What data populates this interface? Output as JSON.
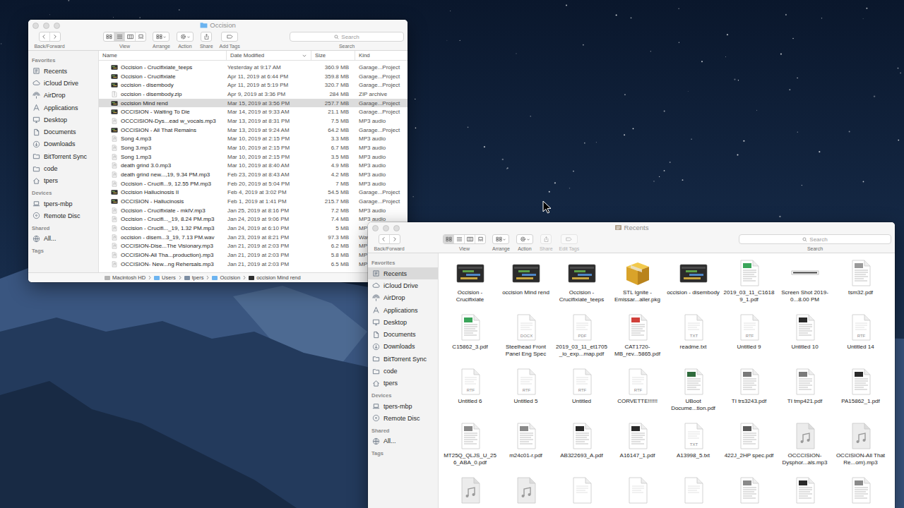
{
  "windows": [
    {
      "kind": "list",
      "title": "Occision",
      "active": false,
      "toolbar": [
        {
          "label": "Back/Forward",
          "kind": "nav",
          "disabled": false
        },
        {
          "label": "View",
          "kind": "view",
          "disabled": false
        },
        {
          "label": "Arrange",
          "kind": "arrange",
          "disabled": false
        },
        {
          "label": "Action",
          "kind": "action",
          "disabled": false
        },
        {
          "label": "Share",
          "kind": "share",
          "disabled": false
        },
        {
          "label": "Add Tags",
          "kind": "tags",
          "disabled": false
        }
      ],
      "view_modes": [
        {
          "kind": "icon",
          "selected": false
        },
        {
          "kind": "list",
          "selected": true
        },
        {
          "kind": "column",
          "selected": false
        },
        {
          "kind": "gallery",
          "selected": false
        }
      ],
      "search": {
        "placeholder": "Search",
        "label": "Search"
      },
      "sidebar": [
        {
          "heading": "Favorites",
          "items": [
            {
              "label": "Recents",
              "kind": "recents",
              "selected": false
            },
            {
              "label": "iCloud Drive",
              "kind": "cloud",
              "selected": false
            },
            {
              "label": "AirDrop",
              "kind": "airdrop",
              "selected": false
            },
            {
              "label": "Applications",
              "kind": "apps",
              "selected": false
            },
            {
              "label": "Desktop",
              "kind": "desktop",
              "selected": false
            },
            {
              "label": "Documents",
              "kind": "documents",
              "selected": false
            },
            {
              "label": "Downloads",
              "kind": "downloads",
              "selected": false
            },
            {
              "label": "BitTorrent Sync",
              "kind": "folder",
              "selected": false
            },
            {
              "label": "code",
              "kind": "folder",
              "selected": false
            },
            {
              "label": "tpers",
              "kind": "home",
              "selected": false
            }
          ]
        },
        {
          "heading": "Devices",
          "items": [
            {
              "label": "tpers-mbp",
              "kind": "laptop",
              "selected": false
            },
            {
              "label": "Remote Disc",
              "kind": "disc",
              "selected": false
            }
          ]
        },
        {
          "heading": "Shared",
          "items": [
            {
              "label": "All...",
              "kind": "network",
              "selected": false
            }
          ]
        },
        {
          "heading": "Tags",
          "items": []
        }
      ],
      "columns": [
        {
          "label": "Name",
          "sorted": false
        },
        {
          "label": "Date Modified",
          "sorted": true
        },
        {
          "label": "Size",
          "sorted": false
        },
        {
          "label": "Kind",
          "sorted": false
        }
      ],
      "rows": [
        {
          "name": "Occision - Crucifixiate_teeps",
          "date": "Yesterday at 9:17 AM",
          "size": "360.9 MB",
          "kind_label": "Garage...Project",
          "kind": "project",
          "selected": false
        },
        {
          "name": "Occision - Crucifixiate",
          "date": "Apr 11, 2019 at 6:44 PM",
          "size": "359.8 MB",
          "kind_label": "Garage...Project",
          "kind": "project",
          "selected": false
        },
        {
          "name": "occision - disembody",
          "date": "Apr 11, 2019 at 5:19 PM",
          "size": "320.7 MB",
          "kind_label": "Garage...Project",
          "kind": "project",
          "selected": false
        },
        {
          "name": "occision - disembody.zip",
          "date": "Apr 9, 2019 at 3:36 PM",
          "size": "284 MB",
          "kind_label": "ZIP archive",
          "kind": "archive",
          "selected": false
        },
        {
          "name": "occision Mind rend",
          "date": "Mar 15, 2019 at 3:56 PM",
          "size": "257.7 MB",
          "kind_label": "Garage...Project",
          "kind": "project",
          "selected": true
        },
        {
          "name": "OCCISION - Waiting To Die",
          "date": "Mar 14, 2019 at 9:33 AM",
          "size": "21.1 MB",
          "kind_label": "Garage...Project",
          "kind": "project",
          "selected": false
        },
        {
          "name": "OCCCISION-Dys...ead w_vocals.mp3",
          "date": "Mar 13, 2019 at 8:31 PM",
          "size": "7.5 MB",
          "kind_label": "MP3 audio",
          "kind": "audio",
          "selected": false
        },
        {
          "name": "OCCISION - All That Remains",
          "date": "Mar 13, 2019 at 9:24 AM",
          "size": "64.2 MB",
          "kind_label": "Garage...Project",
          "kind": "project",
          "selected": false
        },
        {
          "name": "Song 4.mp3",
          "date": "Mar 10, 2019 at 2:15 PM",
          "size": "3.3 MB",
          "kind_label": "MP3 audio",
          "kind": "audio",
          "selected": false
        },
        {
          "name": "Song 3.mp3",
          "date": "Mar 10, 2019 at 2:15 PM",
          "size": "6.7 MB",
          "kind_label": "MP3 audio",
          "kind": "audio",
          "selected": false
        },
        {
          "name": "Song 1.mp3",
          "date": "Mar 10, 2019 at 2:15 PM",
          "size": "3.5 MB",
          "kind_label": "MP3 audio",
          "kind": "audio",
          "selected": false
        },
        {
          "name": "death grind 3.0.mp3",
          "date": "Mar 10, 2019 at 8:40 AM",
          "size": "4.9 MB",
          "kind_label": "MP3 audio",
          "kind": "audio",
          "selected": false
        },
        {
          "name": "death grind new...,19, 9.34 PM.mp3",
          "date": "Feb 23, 2019 at 8:43 AM",
          "size": "4.2 MB",
          "kind_label": "MP3 audio",
          "kind": "audio",
          "selected": false
        },
        {
          "name": "Occision - Crucifi...9, 12.55 PM.mp3",
          "date": "Feb 20, 2019 at 5:04 PM",
          "size": "7 MB",
          "kind_label": "MP3 audio",
          "kind": "audio",
          "selected": false
        },
        {
          "name": "Occision Hallucinosis II",
          "date": "Feb 4, 2019 at 3:02 PM",
          "size": "54.5 MB",
          "kind_label": "Garage...Project",
          "kind": "project",
          "selected": false
        },
        {
          "name": "OCCISION - Hallucinosis",
          "date": "Feb 1, 2019 at 1:41 PM",
          "size": "215.7 MB",
          "kind_label": "Garage...Project",
          "kind": "project",
          "selected": false
        },
        {
          "name": "Occision - Crucifixiate - mkIV.mp3",
          "date": "Jan 25, 2019 at 8:16 PM",
          "size": "7.2 MB",
          "kind_label": "MP3 audio",
          "kind": "audio",
          "selected": false
        },
        {
          "name": "Occision - Crucifi..._19, 8.24 PM.mp3",
          "date": "Jan 24, 2019 at 9:06 PM",
          "size": "7.4 MB",
          "kind_label": "MP3 audio",
          "kind": "audio",
          "selected": false
        },
        {
          "name": "Occision - Crucifi..._19, 1.32 PM.mp3",
          "date": "Jan 24, 2019 at 6:10 PM",
          "size": "5 MB",
          "kind_label": "MP",
          "kind": "audio",
          "selected": false
        },
        {
          "name": "occision - disem...3_19, 7.13 PM.wav",
          "date": "Jan 23, 2019 at 8:21 PM",
          "size": "97.3 MB",
          "kind_label": "Wav",
          "kind": "audio",
          "selected": false
        },
        {
          "name": "OCCISION-Dise...The Visionary.mp3",
          "date": "Jan 21, 2019 at 2:03 PM",
          "size": "6.2 MB",
          "kind_label": "MP",
          "kind": "audio",
          "selected": false
        },
        {
          "name": "OCCISION-All Tha...production).mp3",
          "date": "Jan 21, 2019 at 2:03 PM",
          "size": "5.8 MB",
          "kind_label": "MP",
          "kind": "audio",
          "selected": false
        },
        {
          "name": "OCCISION- New...ng Rehersals.mp3",
          "date": "Jan 21, 2019 at 2:03 PM",
          "size": "6.5 MB",
          "kind_label": "MP",
          "kind": "audio",
          "selected": false
        }
      ],
      "path": [
        {
          "label": "Macintosh HD",
          "kind": "disk"
        },
        {
          "label": "Users",
          "kind": "folder"
        },
        {
          "label": "tpers",
          "kind": "home"
        },
        {
          "label": "Occision",
          "kind": "folder"
        },
        {
          "label": "occision Mind rend",
          "kind": "project"
        }
      ]
    },
    {
      "kind": "icons",
      "title": "Recents",
      "active": false,
      "toolbar": [
        {
          "label": "Back/Forward",
          "kind": "nav",
          "disabled": false
        },
        {
          "label": "View",
          "kind": "view",
          "disabled": false
        },
        {
          "label": "Arrange",
          "kind": "arrange",
          "disabled": false
        },
        {
          "label": "Action",
          "kind": "action",
          "disabled": false
        },
        {
          "label": "Share",
          "kind": "share",
          "disabled": true
        },
        {
          "label": "Edit Tags",
          "kind": "tags",
          "disabled": true
        }
      ],
      "view_modes": [
        {
          "kind": "icon",
          "selected": true
        },
        {
          "kind": "list",
          "selected": false
        },
        {
          "kind": "column",
          "selected": false
        },
        {
          "kind": "gallery",
          "selected": false
        }
      ],
      "search": {
        "placeholder": "Search",
        "label": "Search"
      },
      "sidebar": [
        {
          "heading": "Favorites",
          "items": [
            {
              "label": "Recents",
              "kind": "recents",
              "selected": true
            },
            {
              "label": "iCloud Drive",
              "kind": "cloud",
              "selected": false
            },
            {
              "label": "AirDrop",
              "kind": "airdrop",
              "selected": false
            },
            {
              "label": "Applications",
              "kind": "apps",
              "selected": false
            },
            {
              "label": "Desktop",
              "kind": "desktop",
              "selected": false
            },
            {
              "label": "Documents",
              "kind": "documents",
              "selected": false
            },
            {
              "label": "Downloads",
              "kind": "downloads",
              "selected": false
            },
            {
              "label": "BitTorrent Sync",
              "kind": "folder",
              "selected": false
            },
            {
              "label": "code",
              "kind": "folder",
              "selected": false
            },
            {
              "label": "tpers",
              "kind": "home",
              "selected": false
            }
          ]
        },
        {
          "heading": "Devices",
          "items": [
            {
              "label": "tpers-mbp",
              "kind": "laptop",
              "selected": false
            },
            {
              "label": "Remote Disc",
              "kind": "disc",
              "selected": false
            }
          ]
        },
        {
          "heading": "Shared",
          "items": [
            {
              "label": "All...",
              "kind": "network",
              "selected": false
            }
          ]
        },
        {
          "heading": "Tags",
          "items": []
        }
      ],
      "items": [
        {
          "name": "Occision - Crucifixiate",
          "kind": "project"
        },
        {
          "name": "occision Mind rend",
          "kind": "project"
        },
        {
          "name": "Occision - Crucifixiate_teeps",
          "kind": "project"
        },
        {
          "name": "STL Ignite - Emissar...aller.pkg",
          "kind": "package"
        },
        {
          "name": "occision - disembody",
          "kind": "project"
        },
        {
          "name": "2019_03_11_C16189_1.pdf",
          "kind": "preview",
          "color": "#3aa55a"
        },
        {
          "name": "Screen Shot 2019-0...8.00 PM",
          "kind": "screenshot"
        },
        {
          "name": "tsm32.pdf",
          "kind": "preview",
          "color": "#9a9a9a"
        },
        {
          "name": "C15862_3.pdf",
          "kind": "preview",
          "color": "#3aa55a"
        },
        {
          "name": "Steelhead Front Panel Eng Spec",
          "kind": "doc",
          "badge": "DOCX"
        },
        {
          "name": "2019_03_11_et1705_io_exp...map.pdf",
          "kind": "doc",
          "badge": "PDF"
        },
        {
          "name": "CAT1720-MB_rev...5865.pdf",
          "kind": "preview",
          "color": "#d0403a"
        },
        {
          "name": "readme.txt",
          "kind": "doc",
          "badge": "TXT"
        },
        {
          "name": "Untitled 9",
          "kind": "doc",
          "badge": "RTF"
        },
        {
          "name": "Untitled 10",
          "kind": "preview",
          "color": "#2a2a2a"
        },
        {
          "name": "Untitled 14",
          "kind": "doc",
          "badge": "RTF"
        },
        {
          "name": "Untitled 6",
          "kind": "doc",
          "badge": "RTF"
        },
        {
          "name": "Untitled 5",
          "kind": "doc",
          "badge": "RTF"
        },
        {
          "name": "Untitled",
          "kind": "doc",
          "badge": "RTF"
        },
        {
          "name": "CORVETTE!!!!!!",
          "kind": "doc",
          "badge": "RTF"
        },
        {
          "name": "UBoot Docume...tion.pdf",
          "kind": "preview",
          "color": "#2f6b3c"
        },
        {
          "name": "TI trs3243.pdf",
          "kind": "preview",
          "color": "#7a7a7a"
        },
        {
          "name": "TI tmp421.pdf",
          "kind": "preview",
          "color": "#7a7a7a"
        },
        {
          "name": "PA15862_1.pdf",
          "kind": "preview",
          "color": "#2a2a2a"
        },
        {
          "name": "MT25Q_QLJS_U_256_ABA_0.pdf",
          "kind": "preview",
          "color": "#8a8a8a"
        },
        {
          "name": "m24c01-r.pdf",
          "kind": "preview",
          "color": "#8a8a8a"
        },
        {
          "name": "AB322693_A.pdf",
          "kind": "preview",
          "color": "#2a2a2a"
        },
        {
          "name": "A16147_1.pdf",
          "kind": "preview",
          "color": "#2a2a2a"
        },
        {
          "name": "A13998_5.txt",
          "kind": "doc",
          "badge": "TXT"
        },
        {
          "name": "422J_2HP spec.pdf",
          "kind": "preview",
          "color": "#5c5c5c"
        },
        {
          "name": "OCCCISION-Dysphor...als.mp3",
          "kind": "audio"
        },
        {
          "name": "OCCISION-All That Re...om).mp3",
          "kind": "audio"
        },
        {
          "kind": "audio"
        },
        {
          "kind": "audio"
        },
        {
          "kind": "doc"
        },
        {
          "kind": "doc"
        },
        {
          "kind": "doc"
        },
        {
          "kind": "preview",
          "color": "#8a8a8a"
        },
        {
          "kind": "preview",
          "color": "#2a2a2a"
        },
        {
          "kind": "preview",
          "color": "#8a8a8a"
        }
      ]
    }
  ]
}
